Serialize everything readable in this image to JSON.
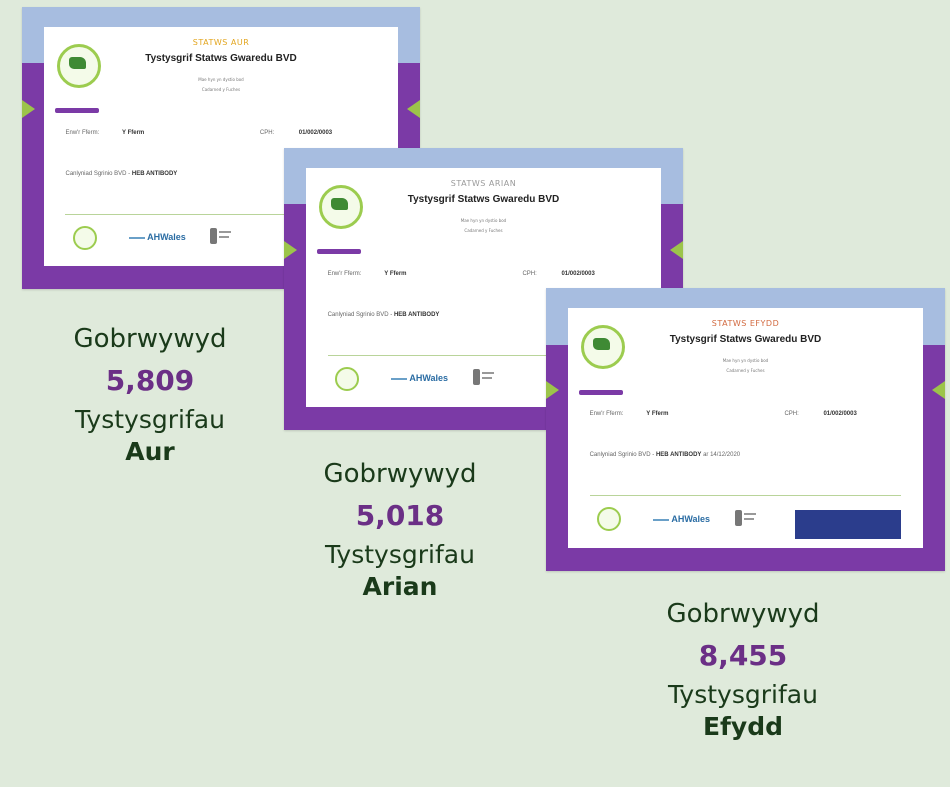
{
  "certificates": [
    {
      "status": "STATWS AUR",
      "status_color": "#e3a61f",
      "title": "Tystysgrif Statws Gwaredu BVD",
      "sub_line1": "Mae hyn yn dystio bod",
      "sub_line2": "Cadarned y Fuches",
      "farm_label": "Enw'r Fferm:",
      "farm_value": "Y Fferm",
      "cph_label": "CPH:",
      "cph_value": "01/002/0003",
      "result_label": "Canlyniad Sgrinio BVD -",
      "result_value": "HEB ANTIBODY",
      "result_extra": ""
    },
    {
      "status": "STATWS ARIAN",
      "status_color": "#9a9a9a",
      "title": "Tystysgrif Statws Gwaredu BVD",
      "sub_line1": "Mae hyn yn dystio bod",
      "sub_line2": "Cadarned y Fuches",
      "farm_label": "Enw'r Fferm:",
      "farm_value": "Y Fferm",
      "cph_label": "CPH:",
      "cph_value": "01/002/0003",
      "result_label": "Canlyniad Sgrinio BVD -",
      "result_value": "HEB ANTIBODY",
      "result_extra": ""
    },
    {
      "status": "STATWS EFYDD",
      "status_color": "#d2693f",
      "title": "Tystysgrif Statws Gwaredu BVD",
      "sub_line1": "Mae hyn yn dystio bod",
      "sub_line2": "Cadarned y Fuches",
      "farm_label": "Enw'r Fferm:",
      "farm_value": "Y Fferm",
      "cph_label": "CPH:",
      "cph_value": "01/002/0003",
      "result_label": "Canlyniad Sgrinio BVD -",
      "result_value": "HEB ANTIBODY",
      "result_extra": "ar  14/12/2020"
    }
  ],
  "stats": [
    {
      "awarded": "Gobrwywyd",
      "count": "5,809",
      "certificates": "Tystysgrifau",
      "level": "Aur"
    },
    {
      "awarded": "Gobrwywyd",
      "count": "5,018",
      "certificates": "Tystysgrifau",
      "level": "Arian"
    },
    {
      "awarded": "Gobrwywyd",
      "count": "8,455",
      "certificates": "Tystysgrifau",
      "level": "Efydd"
    }
  ],
  "logos": {
    "footer_logo": "AHWales",
    "colors": {
      "background": "#dfeadb",
      "accent_purple": "#7b3aa6",
      "number_purple": "#6b2f86",
      "band_blue": "#a7bde0",
      "leaf_green": "#9cc44a"
    }
  }
}
